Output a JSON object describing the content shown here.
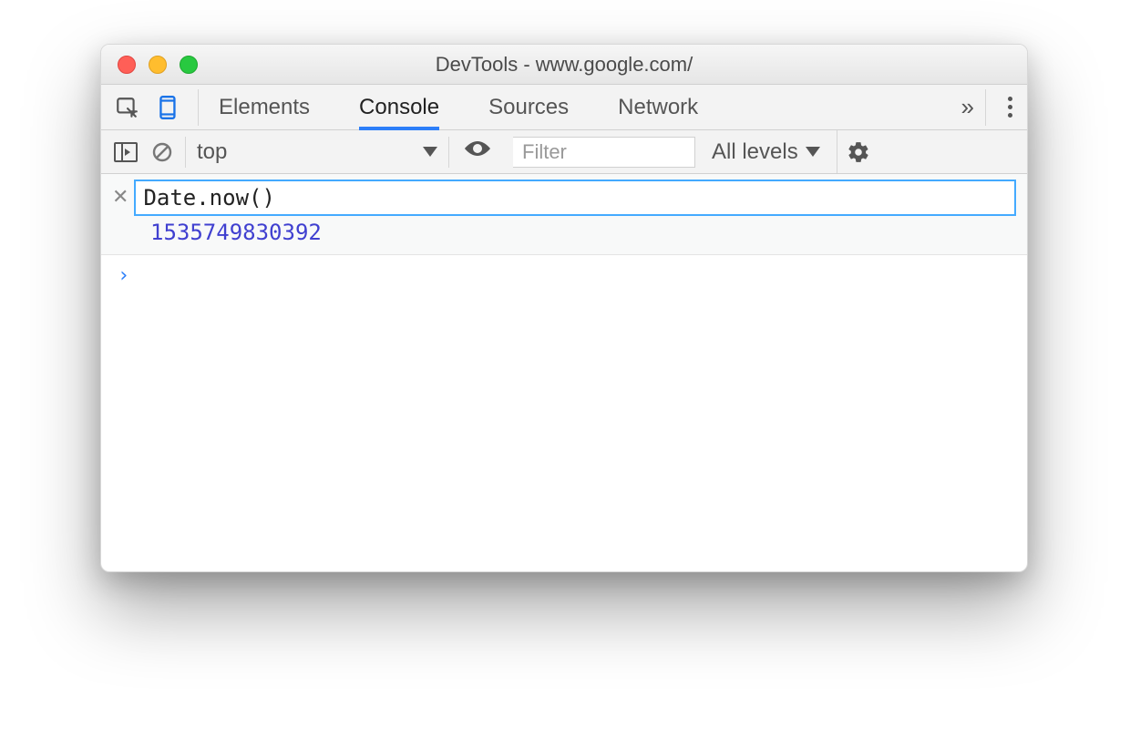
{
  "window": {
    "title": "DevTools - www.google.com/"
  },
  "tabs": {
    "items": [
      "Elements",
      "Console",
      "Sources",
      "Network"
    ],
    "activeIndex": 1,
    "overflowGlyph": "»"
  },
  "toolbar": {
    "context": "top",
    "filterPlaceholder": "Filter",
    "levelsLabel": "All levels"
  },
  "console": {
    "liveExpression": "Date.now()",
    "liveResult": "1535749830392",
    "promptGlyph": "›"
  },
  "icons": {
    "caretDown": "▼"
  }
}
